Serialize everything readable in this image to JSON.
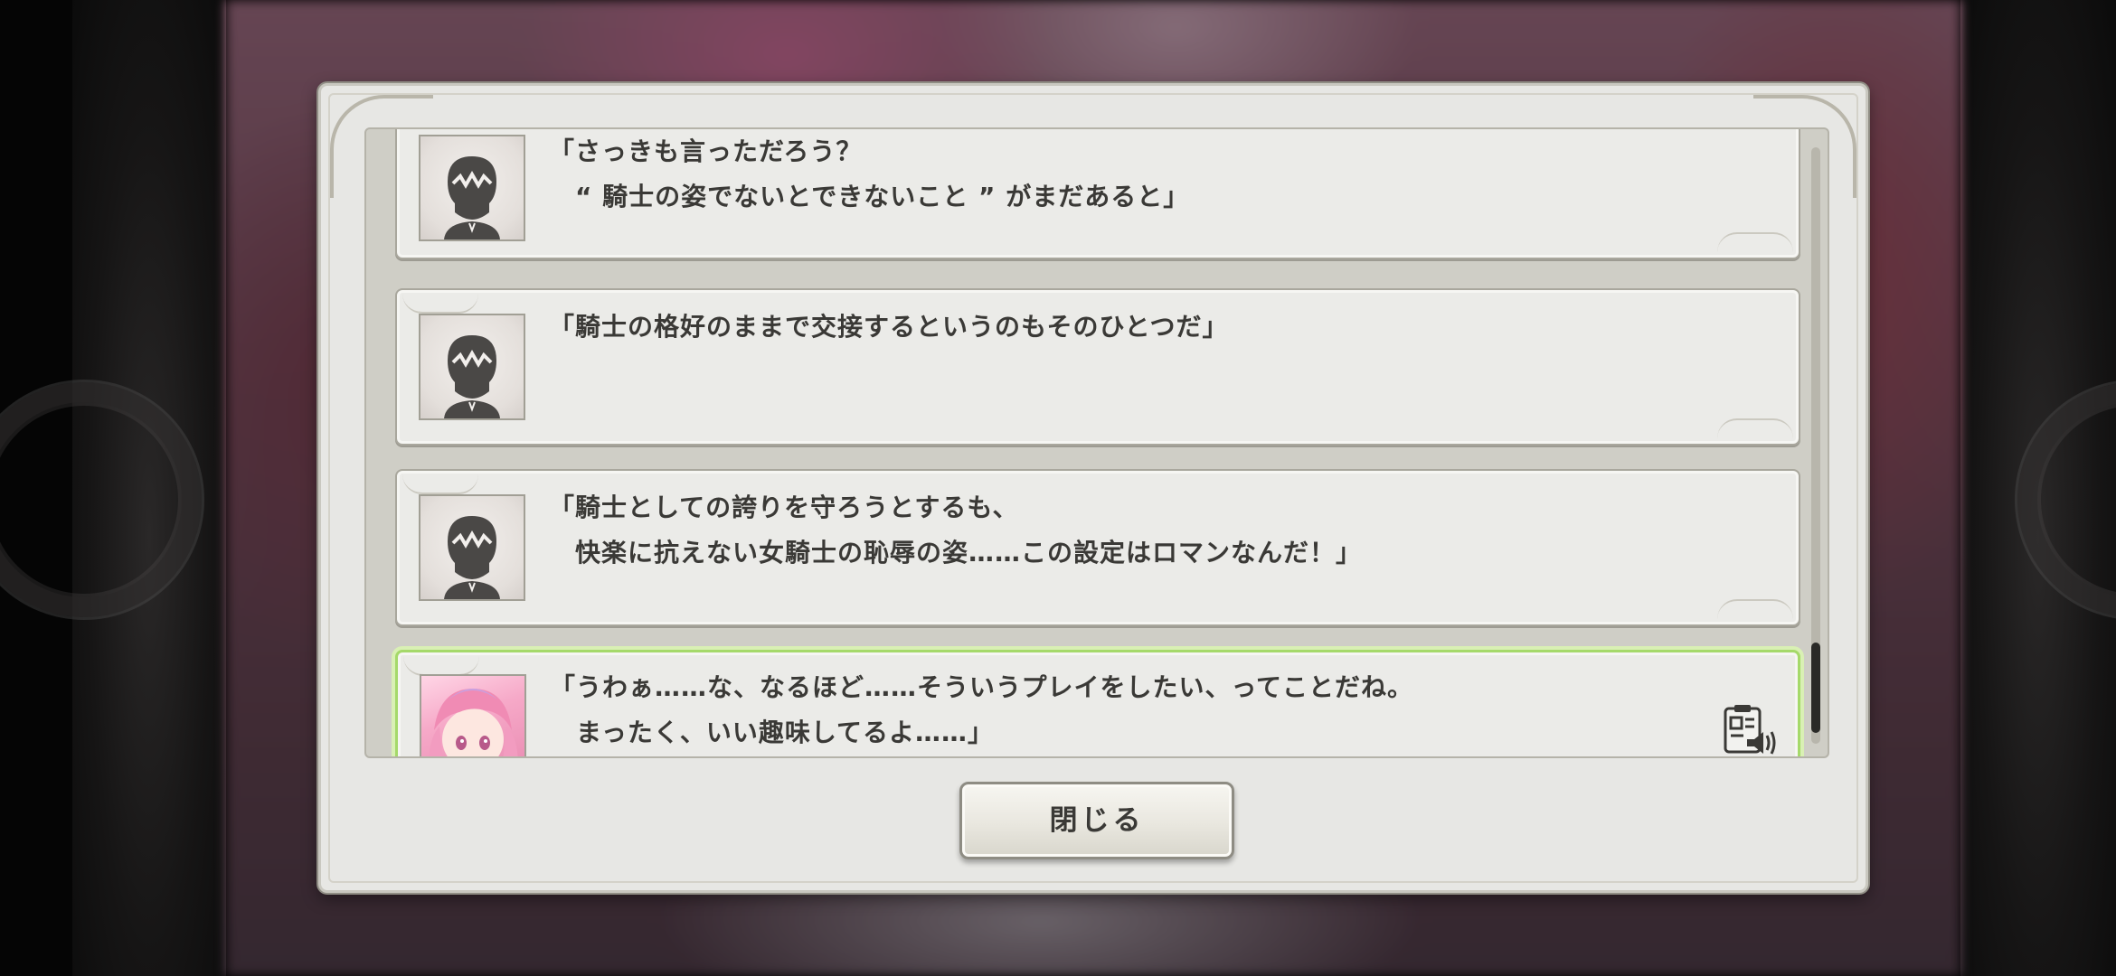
{
  "dialog": {
    "close_label": "閉じる"
  },
  "log": {
    "entries": [
      {
        "speaker_icon": "silhouette-avatar-icon",
        "text": "「さっきも言っただろう？\n　“ 騎士の姿でないとできないこと ” がまだあると」"
      },
      {
        "speaker_icon": "silhouette-avatar-icon",
        "text": "「騎士の格好のままで交接するというのもそのひとつだ」"
      },
      {
        "speaker_icon": "silhouette-avatar-icon",
        "text": "「騎士としての誇りを守ろうとするも、\n　快楽に抗えない女騎士の恥辱の姿……この設定はロマンなんだ！」"
      },
      {
        "speaker_icon": "pink-hair-girl-avatar-icon",
        "text": "「うわぁ……な、なるほど……そういうプレイをしたい、ってことだね。\n　まったく、いい趣味してるよ……」",
        "voice_icon": "voice-replay-icon"
      }
    ]
  },
  "colors": {
    "dialog_bg": "#e7e7e4",
    "active_highlight": "#a5d96a",
    "text": "#3a3936"
  }
}
